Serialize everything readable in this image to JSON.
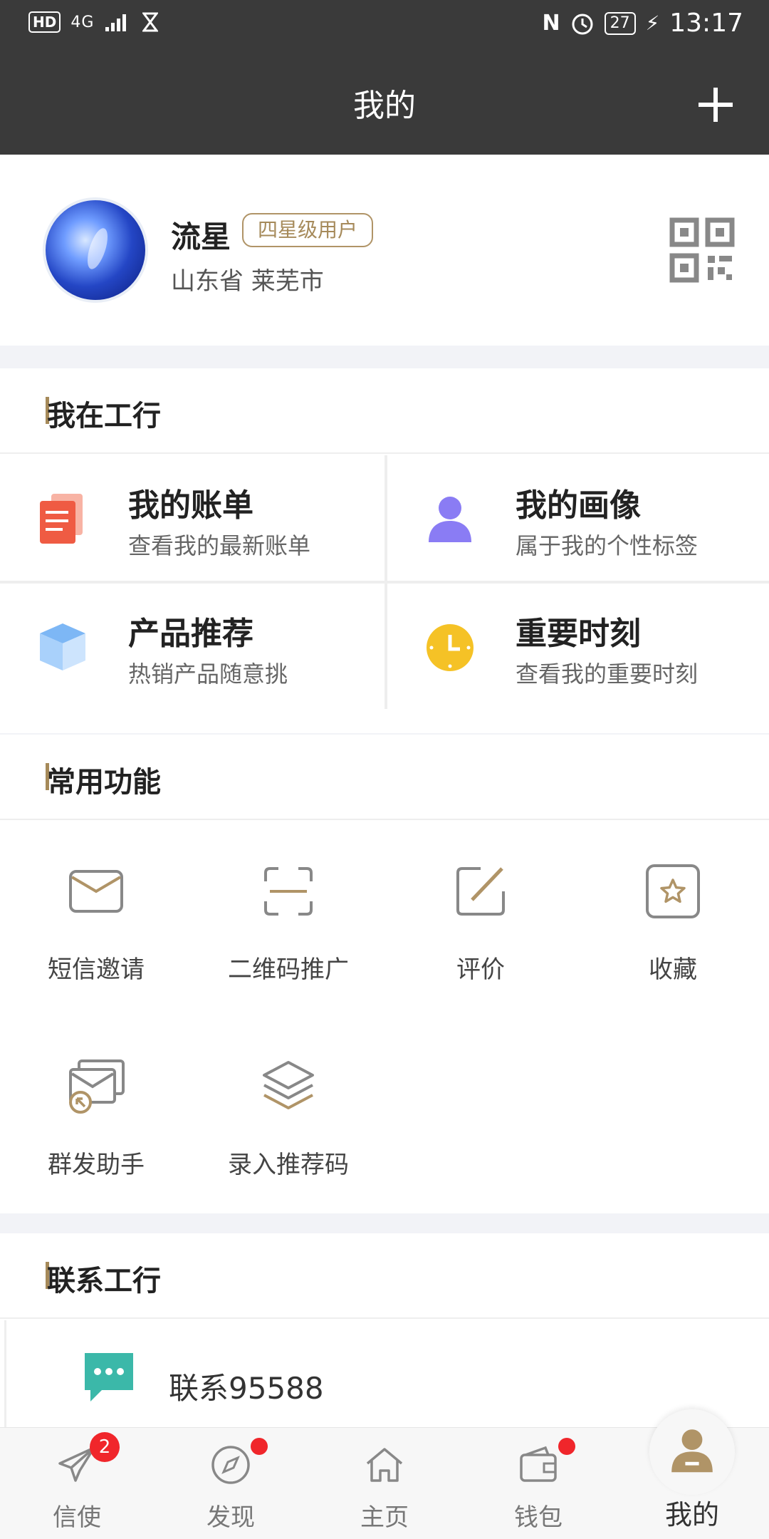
{
  "status_bar": {
    "left": {
      "hd": "HD",
      "network": "4G"
    },
    "right": {
      "nfc": "N",
      "battery": "27",
      "time": "13:17"
    }
  },
  "header": {
    "title": "我的"
  },
  "profile": {
    "name": "流星",
    "level": "四星级用户",
    "location": "山东省 莱芜市"
  },
  "section_icbc": {
    "title": "我在工行",
    "cards": [
      {
        "title": "我的账单",
        "subtitle": "查看我的最新账单",
        "icon": "bill-icon"
      },
      {
        "title": "我的画像",
        "subtitle": "属于我的个性标签",
        "icon": "person-icon"
      },
      {
        "title": "产品推荐",
        "subtitle": "热销产品随意挑",
        "icon": "cube-icon"
      },
      {
        "title": "重要时刻",
        "subtitle": "查看我的重要时刻",
        "icon": "clock-icon"
      }
    ]
  },
  "section_functions": {
    "title": "常用功能",
    "items": [
      {
        "label": "短信邀请",
        "icon": "envelope-icon"
      },
      {
        "label": "二维码推广",
        "icon": "scan-icon"
      },
      {
        "label": "评价",
        "icon": "edit-icon"
      },
      {
        "label": "收藏",
        "icon": "star-icon"
      },
      {
        "label": "群发助手",
        "icon": "broadcast-mail-icon"
      },
      {
        "label": "录入推荐码",
        "icon": "layers-icon"
      }
    ]
  },
  "section_contact": {
    "title": "联系工行",
    "item": {
      "label": "联系95588",
      "icon": "chat-icon"
    }
  },
  "bottom_nav": {
    "items": [
      {
        "label": "信使",
        "icon": "paper-plane-icon",
        "badge": "2"
      },
      {
        "label": "发现",
        "icon": "compass-icon",
        "dot": true
      },
      {
        "label": "主页",
        "icon": "home-icon"
      },
      {
        "label": "钱包",
        "icon": "wallet-icon",
        "dot": true
      },
      {
        "label": "我的",
        "icon": "user-icon",
        "active": true
      }
    ]
  },
  "colors": {
    "accent": "#a68a5a",
    "header_bg": "#3a3a3a",
    "badge": "#f0262b"
  }
}
